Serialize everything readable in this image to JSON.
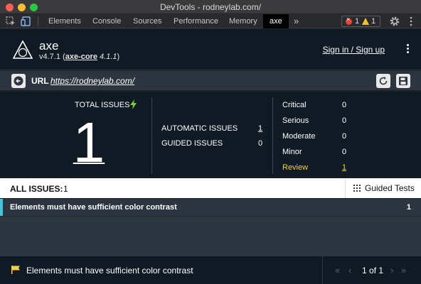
{
  "window": {
    "title": "DevTools - rodneylab.com/"
  },
  "devtools": {
    "tabs": [
      "Elements",
      "Console",
      "Sources",
      "Performance",
      "Memory",
      "axe"
    ],
    "more": "»",
    "errors": "1",
    "warnings": "1"
  },
  "axe": {
    "name": "axe",
    "version": "v4.7.1",
    "core_link": "axe-core",
    "core_version": "4.1.1",
    "signin": "Sign in / Sign up"
  },
  "url": {
    "label": "URL",
    "value": "https://rodneylab.com/"
  },
  "summary": {
    "total_label": "TOTAL ISSUES",
    "total": "1",
    "automatic_label": "AUTOMATIC ISSUES",
    "automatic": "1",
    "guided_label": "GUIDED ISSUES",
    "guided": "0",
    "severity": [
      {
        "label": "Critical",
        "value": "0"
      },
      {
        "label": "Serious",
        "value": "0"
      },
      {
        "label": "Moderate",
        "value": "0"
      },
      {
        "label": "Minor",
        "value": "0"
      },
      {
        "label": "Review",
        "value": "1"
      }
    ]
  },
  "issues": {
    "all_label": "ALL ISSUES:",
    "all_count": "1",
    "guided_tests": "Guided Tests",
    "rows": [
      {
        "title": "Elements must have sufficient color contrast",
        "count": "1"
      }
    ]
  },
  "footer": {
    "title": "Elements must have sufficient color contrast",
    "page": "1",
    "of": "of",
    "total": "1"
  },
  "colors": {
    "accent_review": "#f5cd4f",
    "selected_row": "#4bc0d9",
    "error": "#e8443a",
    "warning": "#f0c330"
  }
}
